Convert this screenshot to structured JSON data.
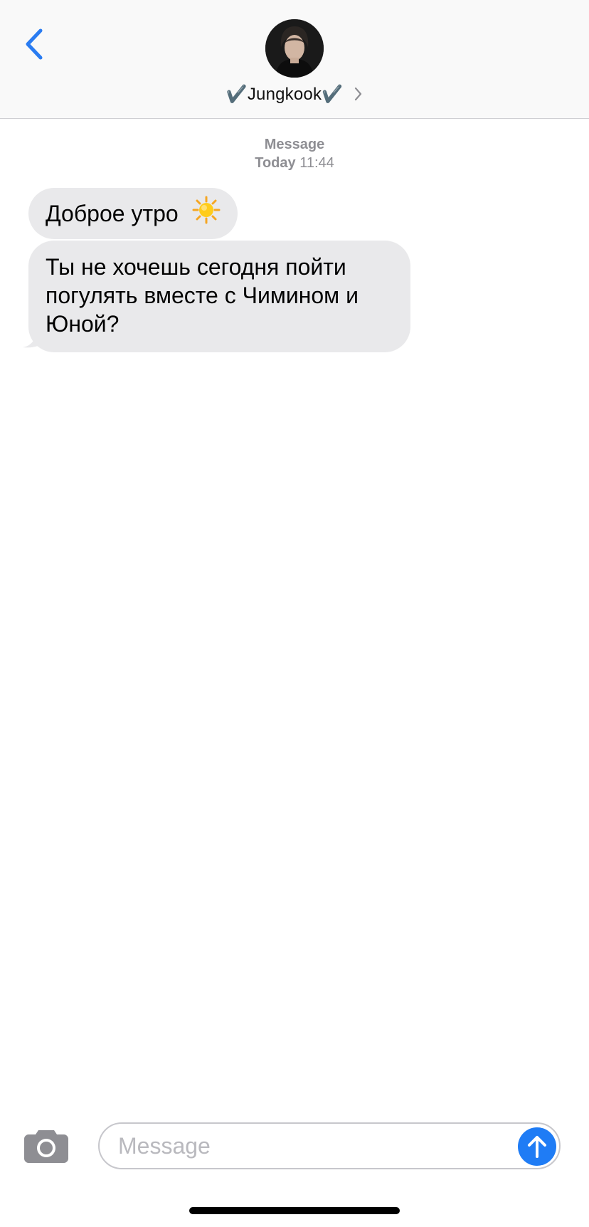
{
  "header": {
    "contact_name": "✔️Jungkook✔️",
    "back_icon": "chevron-left-icon",
    "detail_icon": "chevron-right-icon",
    "avatar": "contact-avatar"
  },
  "timestamp": {
    "service": "Message",
    "day": "Today",
    "time": "11:44"
  },
  "messages": [
    {
      "direction": "incoming",
      "text": "Доброе утро",
      "emoji": "sun-emoji"
    },
    {
      "direction": "incoming",
      "text": "Ты не хочешь сегодня пойти погулять вместе с Чимином и Юной?"
    }
  ],
  "composer": {
    "placeholder": "Message",
    "value": "",
    "camera_icon": "camera-icon",
    "send_icon": "arrow-up-icon"
  },
  "colors": {
    "accent": "#1f7cf5",
    "incoming_bubble": "#e9e9eb",
    "header_bg": "#f9f9f9",
    "secondary_text": "#8e8e93"
  }
}
